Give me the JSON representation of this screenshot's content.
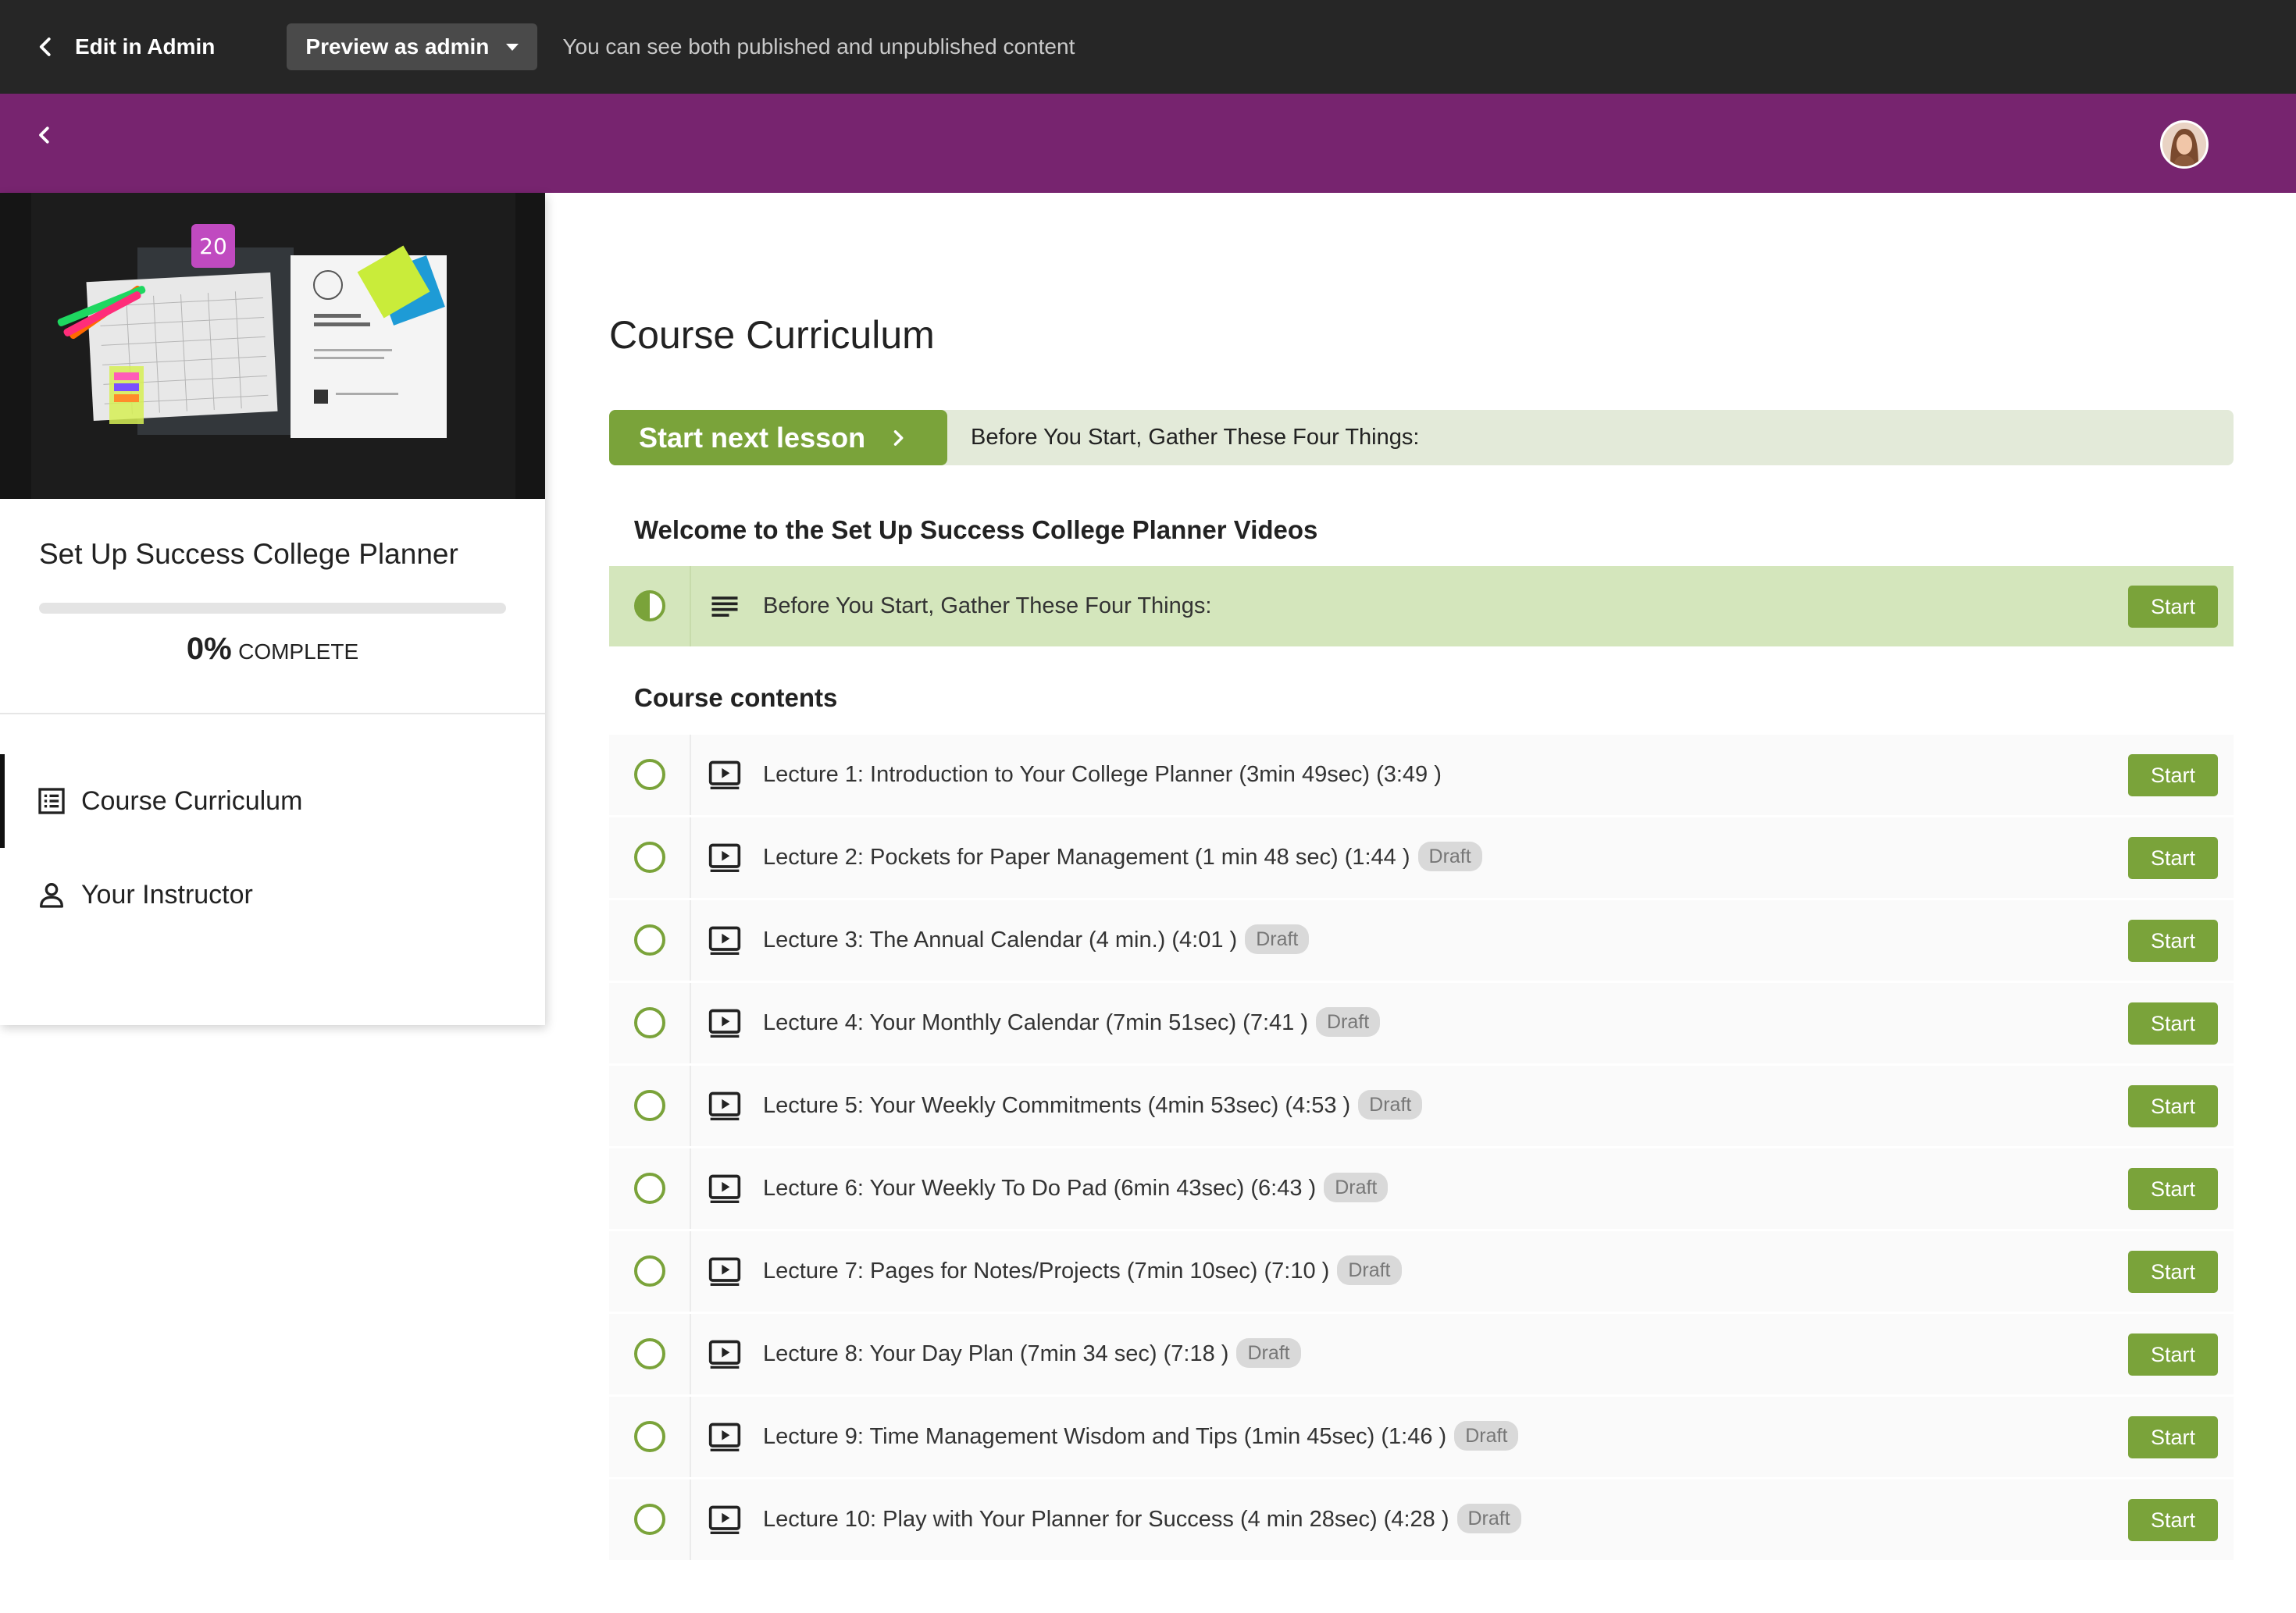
{
  "admin_bar": {
    "back_label": "Edit in Admin",
    "preview_label": "Preview as admin",
    "note": "You can see both published and unpublished content"
  },
  "colors": {
    "brand_purple": "#77246f",
    "accent_green": "#7aa33a",
    "admin_bar": "#262626"
  },
  "sidebar": {
    "course_title": "Set Up Success College Planner",
    "progress_percent": "0%",
    "progress_value": 0,
    "progress_label": "COMPLETE",
    "nav": [
      {
        "label": "Course Curriculum",
        "icon": "list-icon",
        "active": true
      },
      {
        "label": "Your Instructor",
        "icon": "person-icon",
        "active": false
      }
    ]
  },
  "main": {
    "title": "Course Curriculum",
    "next_button_label": "Start next lesson",
    "next_lesson_title": "Before You Start, Gather These Four Things:",
    "sections": [
      {
        "heading": "Welcome to the Set Up Success College Planner Videos",
        "lectures": [
          {
            "title": "Before You Start, Gather These Four Things:",
            "type": "text-icon",
            "status": "in-progress",
            "draft": false,
            "button": "Start"
          }
        ]
      },
      {
        "heading": "Course contents",
        "lectures": [
          {
            "title": "Lecture 1: Introduction to Your College Planner (3min 49sec) (3:49 )",
            "type": "video-icon",
            "status": "not-started",
            "draft": false,
            "button": "Start"
          },
          {
            "title": "Lecture 2: Pockets for Paper Management (1 min 48 sec) (1:44 )",
            "type": "video-icon",
            "status": "not-started",
            "draft": true,
            "badge": "Draft",
            "button": "Start"
          },
          {
            "title": "Lecture 3: The Annual Calendar (4 min.) (4:01 )",
            "type": "video-icon",
            "status": "not-started",
            "draft": true,
            "badge": "Draft",
            "button": "Start"
          },
          {
            "title": "Lecture 4: Your Monthly Calendar (7min 51sec) (7:41 )",
            "type": "video-icon",
            "status": "not-started",
            "draft": true,
            "badge": "Draft",
            "button": "Start"
          },
          {
            "title": "Lecture 5: Your Weekly Commitments (4min 53sec) (4:53 )",
            "type": "video-icon",
            "status": "not-started",
            "draft": true,
            "badge": "Draft",
            "button": "Start"
          },
          {
            "title": "Lecture 6: Your Weekly To Do Pad (6min 43sec) (6:43 )",
            "type": "video-icon",
            "status": "not-started",
            "draft": true,
            "badge": "Draft",
            "button": "Start"
          },
          {
            "title": "Lecture 7: Pages for Notes/Projects (7min 10sec) (7:10 )",
            "type": "video-icon",
            "status": "not-started",
            "draft": true,
            "badge": "Draft",
            "button": "Start"
          },
          {
            "title": "Lecture 8: Your Day Plan (7min 34 sec) (7:18 )",
            "type": "video-icon",
            "status": "not-started",
            "draft": true,
            "badge": "Draft",
            "button": "Start"
          },
          {
            "title": "Lecture 9: Time Management Wisdom and Tips (1min 45sec) (1:46 )",
            "type": "video-icon",
            "status": "not-started",
            "draft": true,
            "badge": "Draft",
            "button": "Start"
          },
          {
            "title": "Lecture 10: Play with Your Planner for Success (4 min 28sec) (4:28 )",
            "type": "video-icon",
            "status": "not-started",
            "draft": true,
            "badge": "Draft",
            "button": "Start"
          }
        ]
      }
    ]
  }
}
